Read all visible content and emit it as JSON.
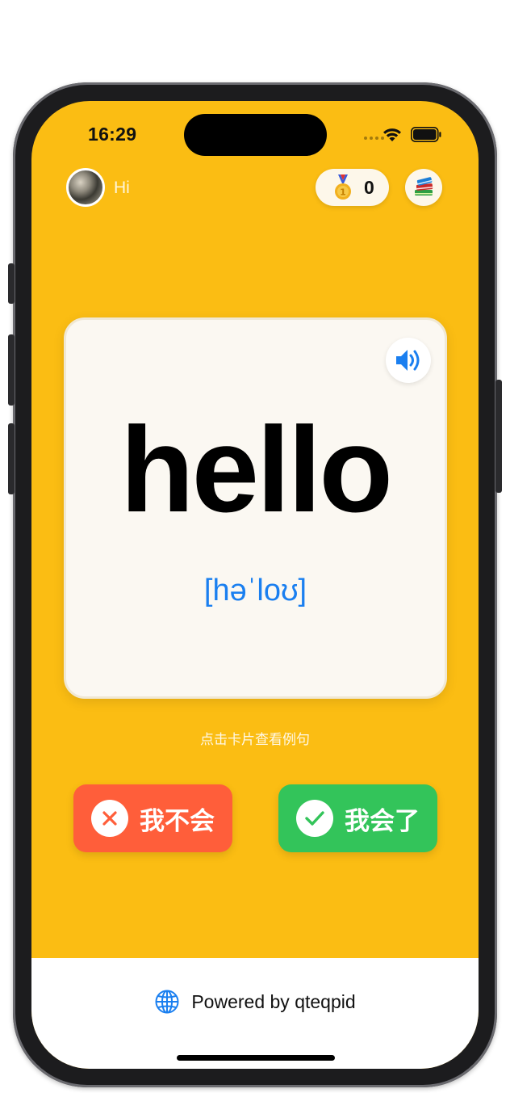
{
  "status_bar": {
    "time": "16:29"
  },
  "header": {
    "greeting": "Hi",
    "coin_count": "0",
    "medal_icon": "medal-icon",
    "wordbook_icon": "books-icon"
  },
  "card": {
    "word": "hello",
    "phonetic": "[həˈloʊ]",
    "speaker_icon": "speaker-icon"
  },
  "hint": "点击卡片查看例句",
  "buttons": {
    "unknown_label": "我不会",
    "known_label": "我会了"
  },
  "footer": {
    "powered_by": "Powered by qteqpid",
    "globe_icon": "globe-icon"
  },
  "colors": {
    "background": "#fbbd13",
    "unknown": "#ff5e3a",
    "known": "#33c45a",
    "phonetic": "#1a7ff0"
  }
}
